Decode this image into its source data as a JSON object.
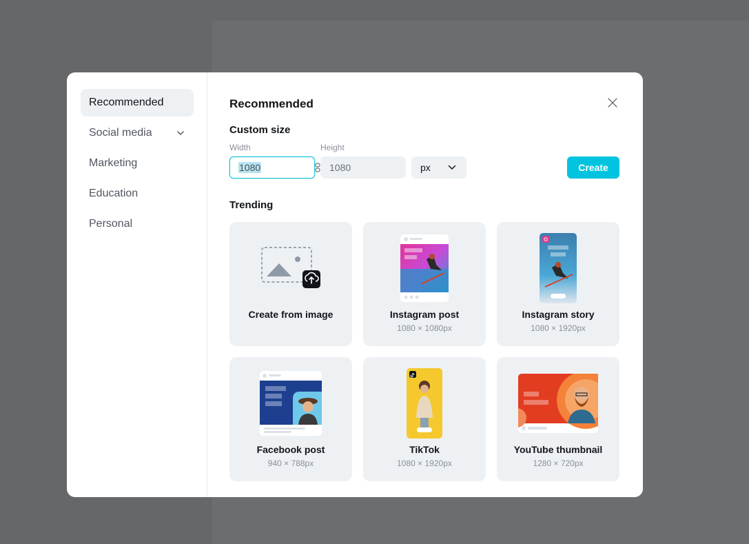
{
  "sidebar": {
    "items": [
      {
        "label": "Recommended"
      },
      {
        "label": "Social media"
      },
      {
        "label": "Marketing"
      },
      {
        "label": "Education"
      },
      {
        "label": "Personal"
      }
    ]
  },
  "main": {
    "title": "Recommended",
    "custom_size": {
      "label": "Custom size",
      "width_label": "Width",
      "height_label": "Height",
      "width_value": "1080",
      "height_value": "1080",
      "unit": "px",
      "create_label": "Create"
    },
    "trending": {
      "label": "Trending",
      "cards": [
        {
          "title": "Create from image",
          "size": ""
        },
        {
          "title": "Instagram post",
          "size": "1080 × 1080px"
        },
        {
          "title": "Instagram story",
          "size": "1080 × 1920px"
        },
        {
          "title": "Facebook post",
          "size": "940 × 788px"
        },
        {
          "title": "TikTok",
          "size": "1080 × 1920px"
        },
        {
          "title": "YouTube thumbnail",
          "size": "1280 × 720px"
        }
      ]
    }
  },
  "colors": {
    "accent": "#00c4df",
    "overlay": "#666768",
    "card_bg": "#eef1f4"
  }
}
